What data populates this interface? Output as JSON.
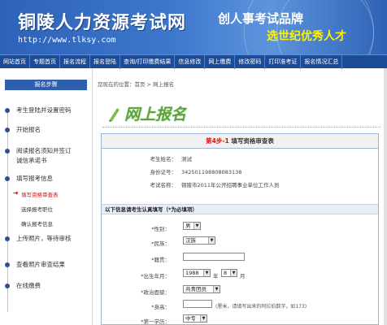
{
  "banner": {
    "title": "铜陵人力资源考试网",
    "url": "http://www.tlksy.com",
    "slogan_1": "创人事考试品牌",
    "slogan_2": "选世纪优秀人才"
  },
  "nav": {
    "items": [
      "网站首页",
      "专题首页",
      "报名流程",
      "报名登陆",
      "查询/打印缴费结果",
      "信息修改",
      "网上缴费",
      "修改密码",
      "打印准考证",
      "报名情况汇总"
    ]
  },
  "sidebar": {
    "header": "报名步骤",
    "steps": [
      {
        "label": "考生登陆并设置密码"
      },
      {
        "label": "开始报名"
      },
      {
        "label": "阅读报名须知并签订"
      },
      {
        "label": "诚信承诺书"
      },
      {
        "label": "填写报考信息"
      },
      {
        "label": "上传照片，等待审核"
      },
      {
        "label": "查看照片审查结果"
      },
      {
        "label": "在线缴费"
      }
    ],
    "substeps": [
      {
        "label": "填写资格审查表"
      },
      {
        "label": "选择报考职位"
      },
      {
        "label": "确认报考信息"
      }
    ]
  },
  "breadcrumb": {
    "prefix": "您现在的位置：",
    "home": "首页",
    "separator": " > ",
    "current": "网上报名"
  },
  "page_heading": "网上报名",
  "form": {
    "step_prefix": "第4步-1",
    "step_title": "填写资格审查表",
    "info": [
      {
        "key": "考生姓名：",
        "value": "测试"
      },
      {
        "key": "身份证号：",
        "value": "342501198808083138"
      },
      {
        "key": "考试名称：",
        "value": "铜陵市2011年公开招聘事业单位工作人员"
      }
    ],
    "notice": "以下信息请考生认真填写（*为必填项）",
    "gender_label": "*性别：",
    "gender_value": "男",
    "ethnicity_label": "*民族：",
    "ethnicity_value": "汉族",
    "native_label": "*籍贯：",
    "native_value": "",
    "birth_label": "*出生年月：",
    "birth_year": "1988",
    "year_unit": "年",
    "birth_month": "8",
    "month_unit": "月",
    "politics_label": "*政治面貌：",
    "politics_value": "共青团员",
    "height_label": "*身高：",
    "height_value": "",
    "height_hint": "(厘米，请填写出来的阿拉伯数字，如173)",
    "edu_label": "*第一学历：",
    "edu_value": "中专"
  },
  "colors": {
    "banner_blue": "#2d62b8",
    "nav_blue": "#1d4b96",
    "heading_green": "#5aa23a",
    "accent_red": "#d01010"
  }
}
